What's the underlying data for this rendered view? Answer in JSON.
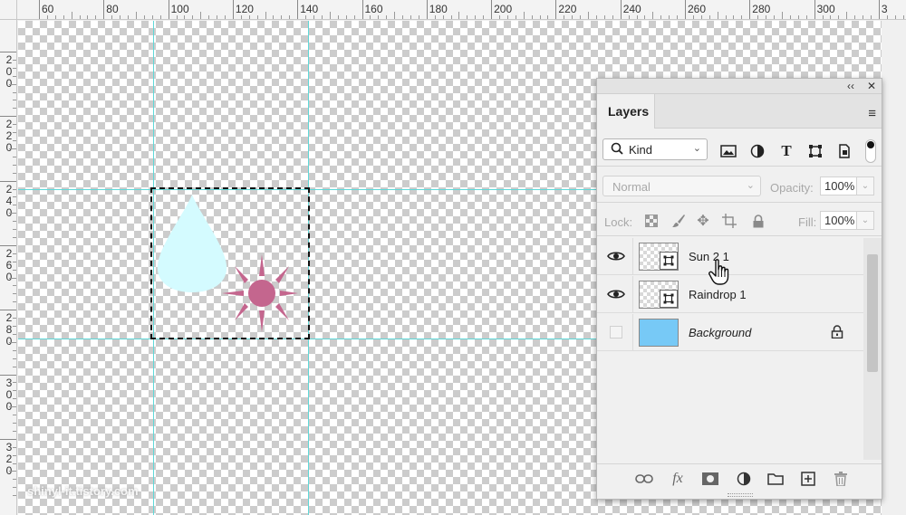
{
  "ruler": {
    "h_labels": [
      "60",
      "80",
      "100",
      "120",
      "140",
      "160",
      "180",
      "200",
      "220",
      "240",
      "260",
      "280",
      "300",
      "3"
    ],
    "v_labels": [
      "200",
      "220",
      "240",
      "260",
      "280",
      "300",
      "320"
    ]
  },
  "watermark": "shinyl-it.tistory.com",
  "panel": {
    "collapse_glyph": "‹‹",
    "close_glyph": "✕",
    "tab_label": "Layers",
    "menu_glyph": "≡",
    "filter": {
      "kind_label": "Kind"
    },
    "blend_mode": "Normal",
    "opacity_label": "Opacity:",
    "opacity_value": "100%",
    "lock_label": "Lock:",
    "fill_label": "Fill:",
    "fill_value": "100%",
    "layers": [
      {
        "name": "Sun 2 1",
        "visible": true
      },
      {
        "name": "Raindrop 1",
        "visible": true
      },
      {
        "name": "Background",
        "visible": false
      }
    ],
    "bottom_icons": [
      "link-icon",
      "fx-icon",
      "mask-icon",
      "adjustment-icon",
      "folder-icon",
      "new-layer-icon",
      "trash-icon"
    ]
  },
  "colors": {
    "guide": "#5fd8d8",
    "raindrop": "#d4fbff",
    "sun": "#c4668e",
    "background_layer": "#77c9f6"
  }
}
